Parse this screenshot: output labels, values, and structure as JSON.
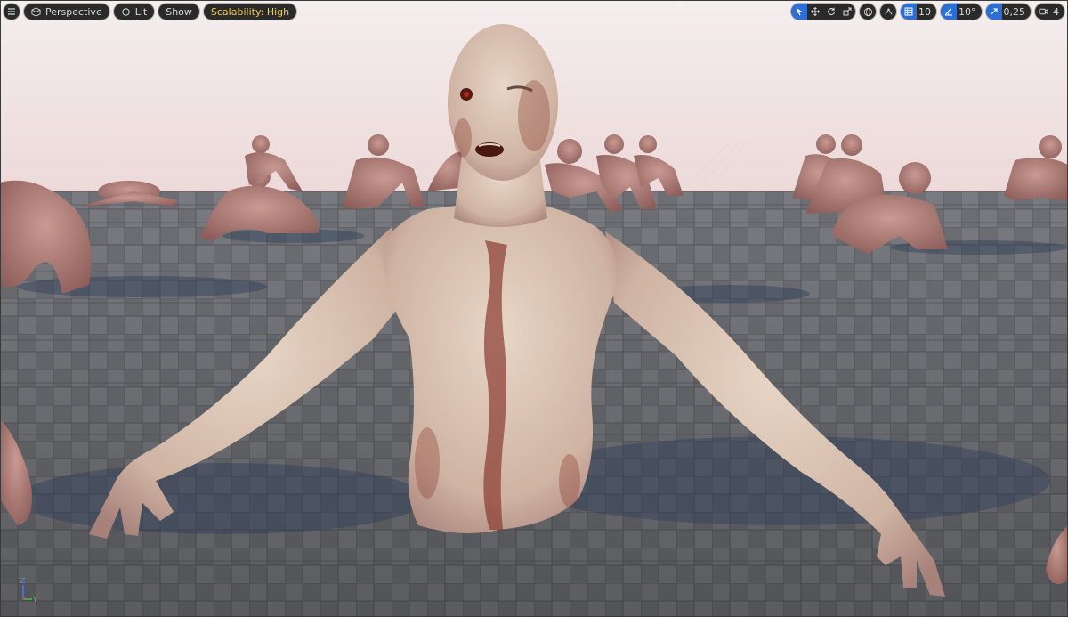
{
  "toolbar": {
    "view_mode": "Perspective",
    "lighting": "Lit",
    "show": "Show",
    "scalability": "Scalability: High",
    "grid_snap_value": "10",
    "rotation_snap_value": "10°",
    "scale_snap_value": "0,25",
    "camera_speed_value": "4"
  },
  "axis": {
    "z_label": "Z",
    "y_label": "Y",
    "x_label": "X"
  },
  "colors": {
    "accent_blue": "#2b6fd6",
    "scalability_yellow": "#f2c94c",
    "toolbar_bg": "#2a2a2a",
    "sky": "#f1e4e4",
    "floor_dark": "#5e5f64",
    "floor_light": "#85868b",
    "skin": "#d9c2b6"
  },
  "icons": {
    "menu": "hamburger-menu-icon",
    "perspective": "cube-icon",
    "lit": "sun-icon",
    "select": "cursor-icon",
    "move": "move-arrows-icon",
    "rotate": "rotate-icon",
    "scale": "scale-icon",
    "world": "globe-icon",
    "surface_snap": "surface-snap-icon",
    "grid_snap": "grid-icon",
    "rotation_snap": "angle-icon",
    "scale_snap": "scale-arrow-icon",
    "camera": "camera-icon"
  }
}
